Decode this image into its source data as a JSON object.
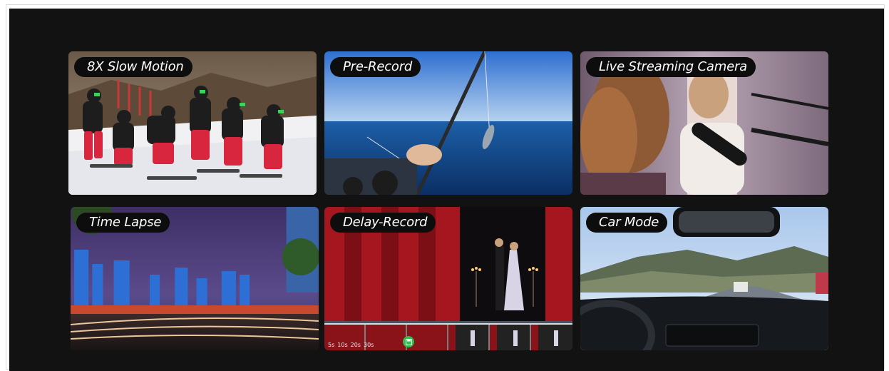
{
  "cards": [
    {
      "id": "slow-motion",
      "label": "8X Slow Motion"
    },
    {
      "id": "pre-record",
      "label": "Pre-Record"
    },
    {
      "id": "live-streaming",
      "label": "Live Streaming Camera"
    },
    {
      "id": "time-lapse",
      "label": "Time Lapse"
    },
    {
      "id": "delay-record",
      "label": "Delay-Record"
    },
    {
      "id": "car-mode",
      "label": "Car Mode"
    }
  ],
  "delay_timeline": {
    "markers": [
      "5s",
      "10s",
      "20s",
      "30s"
    ],
    "icon": "save-icon",
    "accent": "#2fbf4a"
  },
  "colors": {
    "stage_background": "#121212",
    "pill_background": "#0d0d0d",
    "pill_text": "#ffffff"
  }
}
